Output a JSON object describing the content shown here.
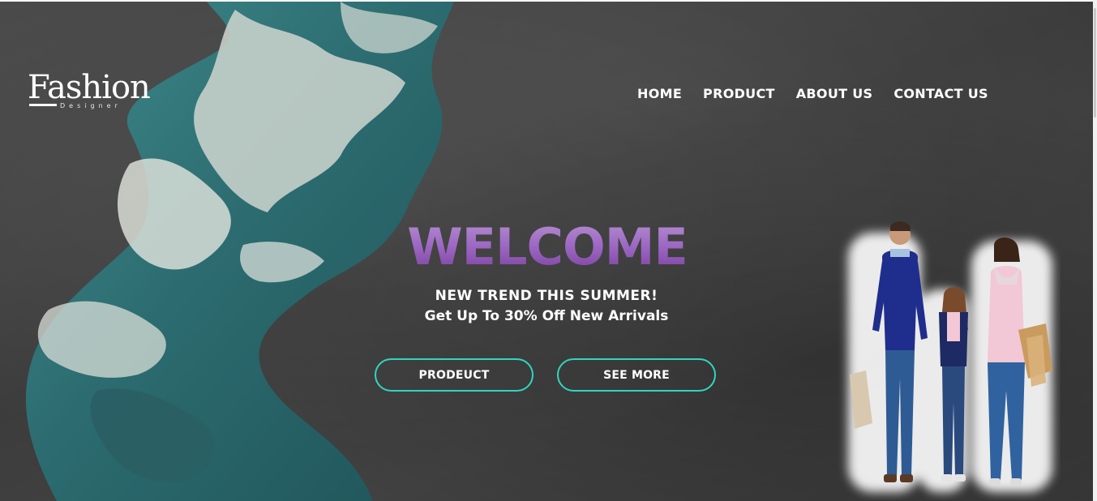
{
  "logo": {
    "main": "Fashion",
    "sub": "Designer"
  },
  "nav": {
    "items": [
      {
        "label": "HOME"
      },
      {
        "label": "PRODUCT"
      },
      {
        "label": "ABOUT US"
      },
      {
        "label": "CONTACT US"
      }
    ]
  },
  "hero": {
    "heading": "WELCOME",
    "line1": "NEW TREND THIS SUMMER!",
    "line2": "Get Up To 30% Off New Arrivals",
    "button_primary": "PRODEUCT",
    "button_secondary": "SEE MORE"
  },
  "colors": {
    "background": "#404040",
    "accent_border": "#2fd6c0",
    "heading_purple": "#9b66c2",
    "cloth_teal": "#2f6e72"
  },
  "icons": [
    "fashion-designer-logo",
    "tie-dye-cloth-image",
    "family-shopping-image"
  ]
}
